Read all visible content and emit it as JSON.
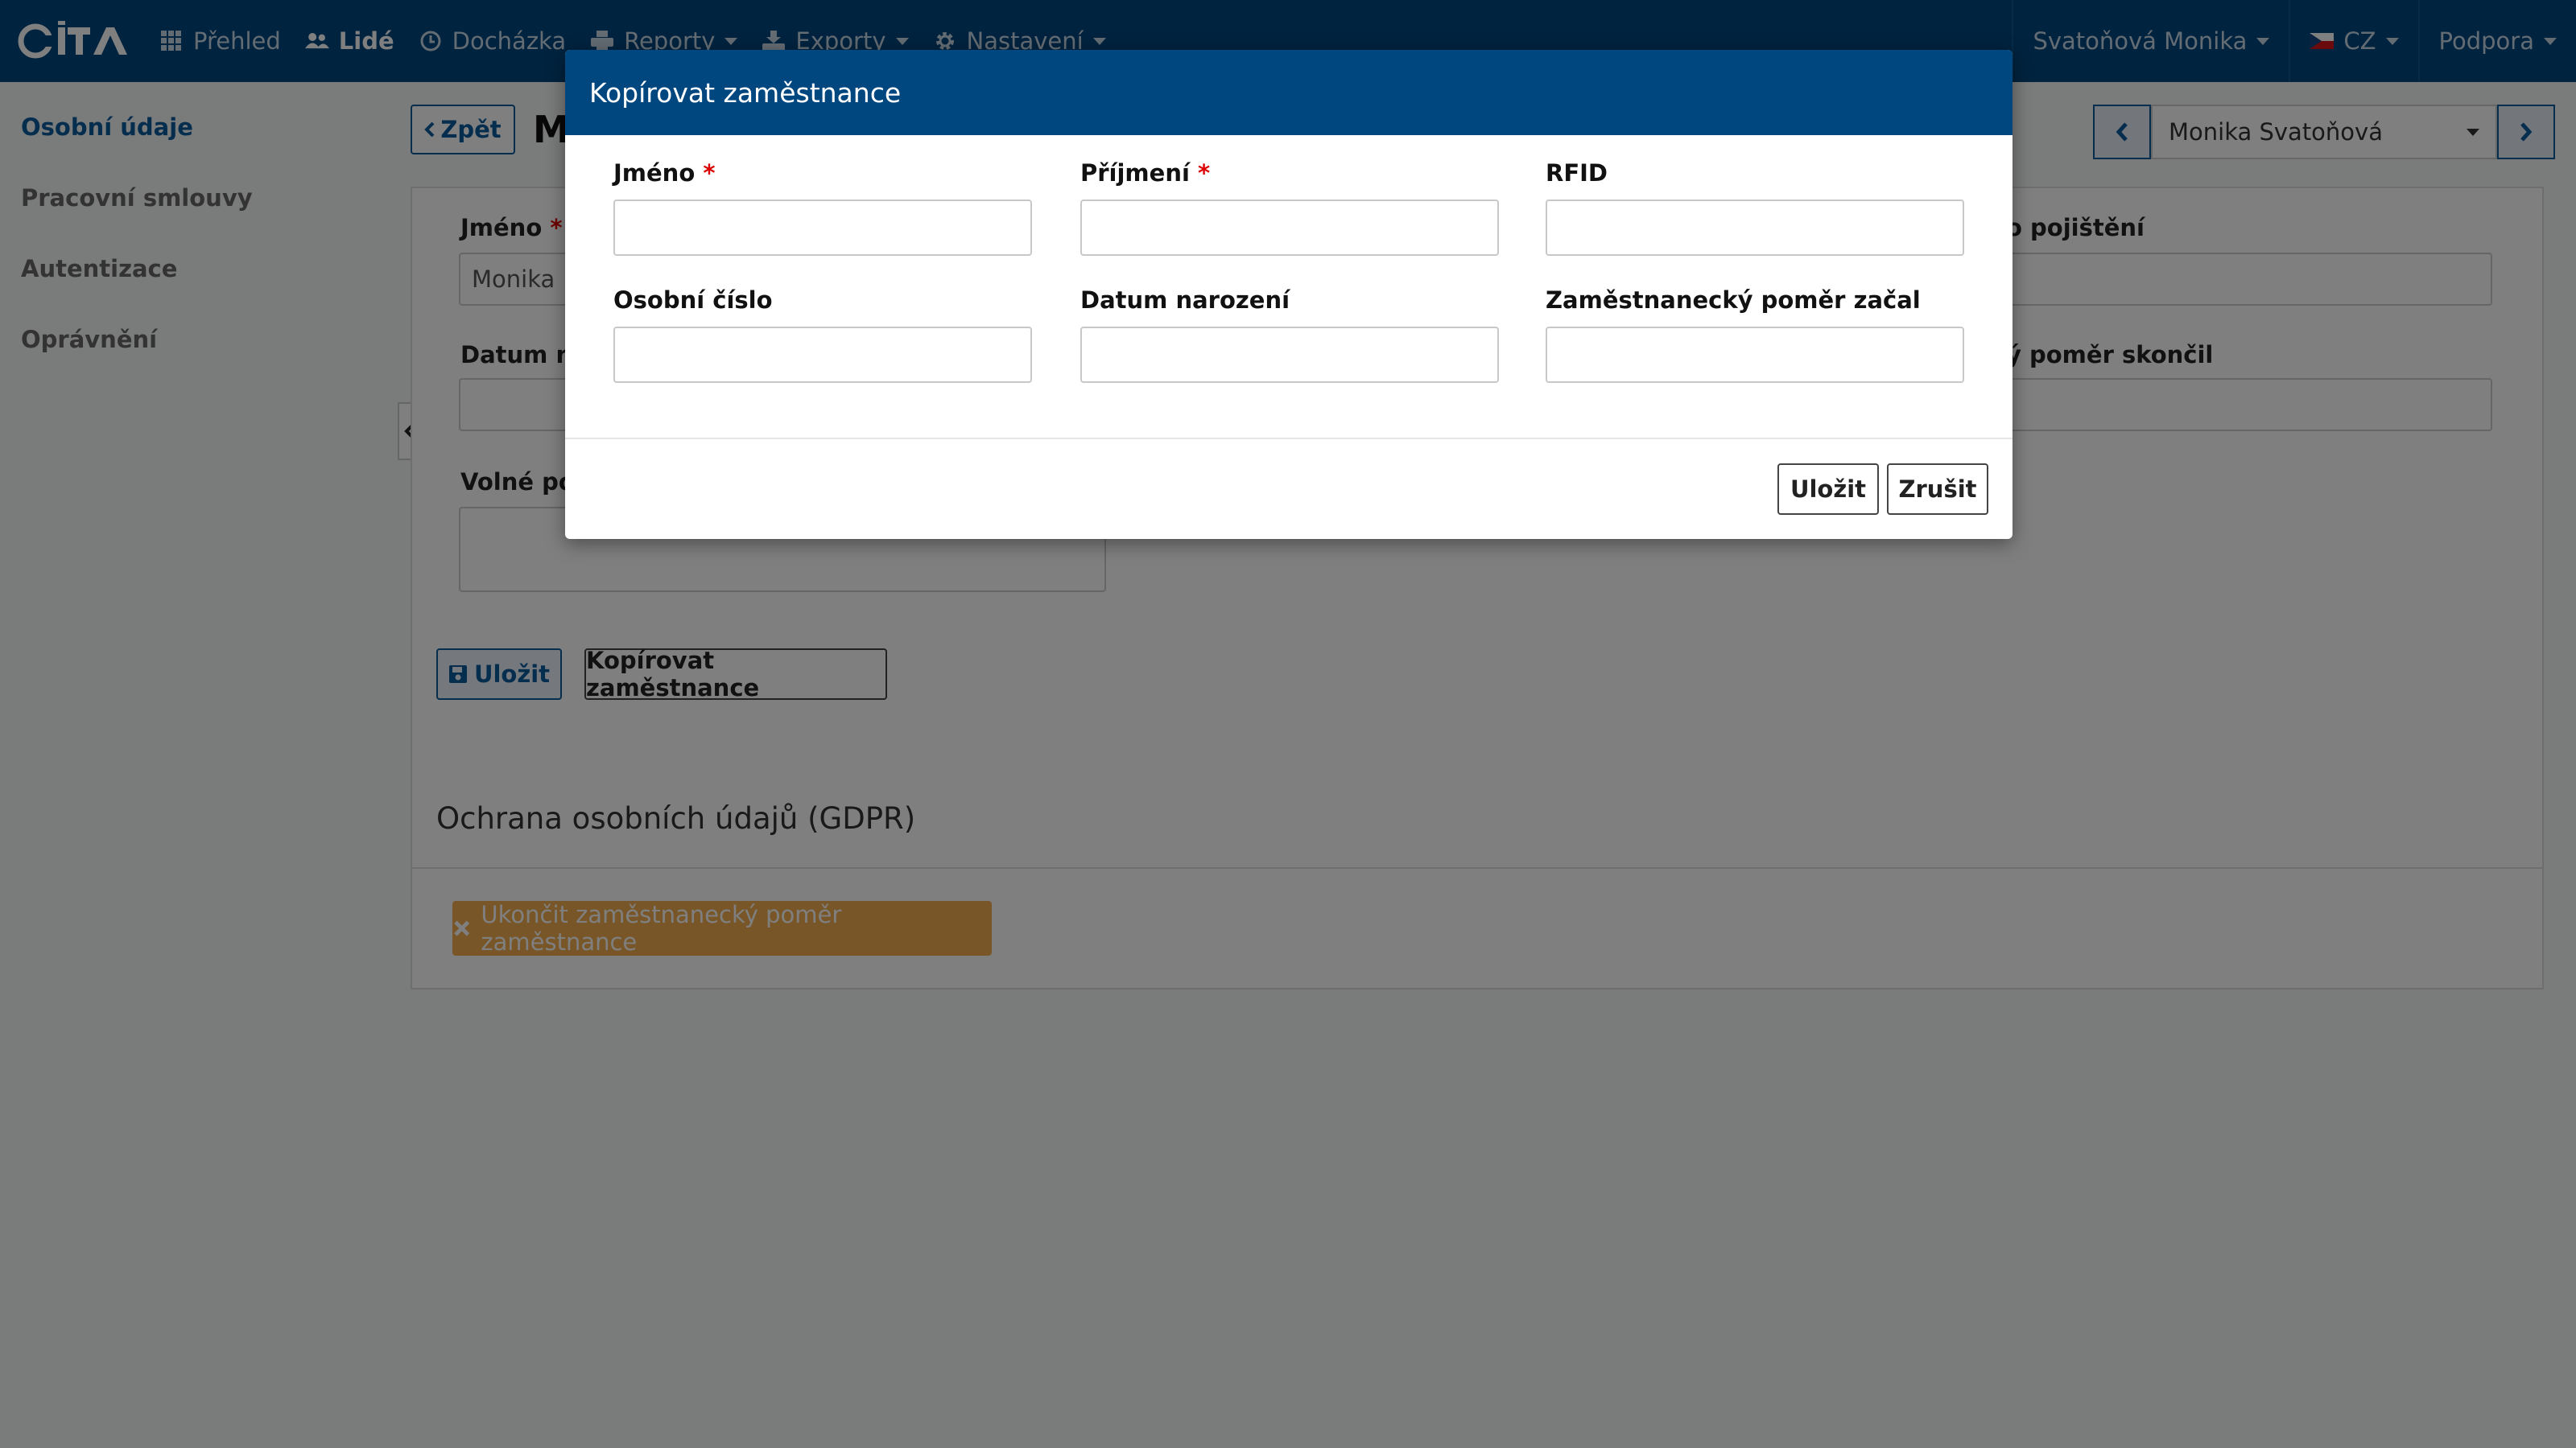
{
  "nav": {
    "items": [
      {
        "label": "Přehled",
        "icon": "grid-icon"
      },
      {
        "label": "Lidé",
        "icon": "users-icon"
      },
      {
        "label": "Docházka",
        "icon": "clock-icon"
      },
      {
        "label": "Reporty",
        "icon": "printer-icon"
      },
      {
        "label": "Exporty",
        "icon": "export-icon"
      },
      {
        "label": "Nastavení",
        "icon": "gear-icon"
      }
    ],
    "user": "Svatoňová Monika",
    "language": "CZ",
    "support": "Podpora"
  },
  "sidebar": {
    "items": [
      {
        "label": "Osobní údaje"
      },
      {
        "label": "Pracovní smlouvy"
      },
      {
        "label": "Autentizace"
      },
      {
        "label": "Oprávnění"
      }
    ]
  },
  "page": {
    "back_label": "Zpět",
    "title_partial": "M",
    "employee_select": "Monika Svatoňová"
  },
  "background_form": {
    "first_name_label": "Jméno",
    "first_name_value": "Monika",
    "birth_date_label_partial": "Datum na",
    "free_fields_label_partial": "Volné pol",
    "insurance_label_partial": "o pojištění",
    "employment_end_label_partial": "ý poměr skončil",
    "save_label": "Uložit",
    "copy_label": "Kopírovat zaměstnance",
    "gdpr_title": "Ochrana osobních údajů (GDPR)",
    "terminate_label": "Ukončit zaměstnanecký poměr zaměstnance"
  },
  "modal": {
    "title": "Kopírovat zaměstnance",
    "fields": {
      "first_name": {
        "label": "Jméno",
        "required": "*",
        "value": ""
      },
      "last_name": {
        "label": "Příjmení",
        "required": "*",
        "value": ""
      },
      "rfid": {
        "label": "RFID",
        "value": ""
      },
      "personal_number": {
        "label": "Osobní číslo",
        "value": ""
      },
      "birth_date": {
        "label": "Datum narození",
        "value": ""
      },
      "employment_start": {
        "label": "Zaměstnanecký poměr začal",
        "value": ""
      }
    },
    "save_label": "Uložit",
    "cancel_label": "Zrušit"
  },
  "colors": {
    "nav_bg": "#00467f",
    "accent": "#0a5a9c",
    "warning": "#f0ad4e",
    "required": "#dd0000"
  }
}
